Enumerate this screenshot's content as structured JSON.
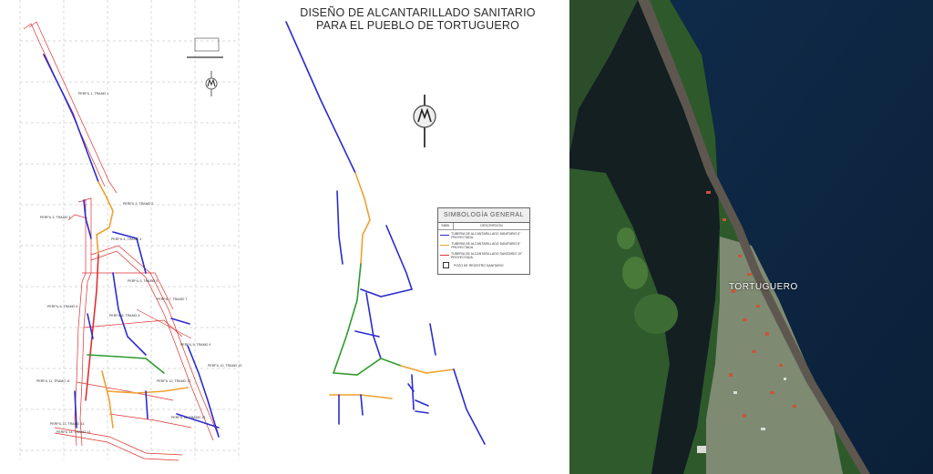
{
  "title": {
    "line1": "DISEÑO DE ALCANTARILLADO SANITARIO",
    "line2": "PARA EL PUEBLO DE TORTUGUERO"
  },
  "legend": {
    "heading": "SIMBOLOGÍA GENERAL",
    "col_symbol": "SIMB.",
    "col_description": "DESCRIPCIÓN",
    "items": [
      {
        "color": "#2b2bd0",
        "text": "TUBERIA DE ALCANTARILLADO SANITARIO 6\" PROYECTADA"
      },
      {
        "color": "#f0a030",
        "text": "TUBERIA DE ALCANTARILLADO SANITARIO 8\" PROYECTADA"
      },
      {
        "color": "#2e9a2e",
        "text": "TUBERIA DE ALCANTARILLADO SANITARIO 8\" PROYECTADA"
      },
      {
        "color": "#e03030",
        "text": "TUBERIA DE ALCANTARILLADO SANITARIO 10\" PROYECTADA"
      },
      {
        "color": "#333333",
        "text": "POZO DE REGISTRO SANITARIO"
      }
    ]
  },
  "plan_labels": [
    "PERFIL 1, TRAMO 1",
    "PERFIL 2, TRAMO 2",
    "PERFIL 3, TRAMO 3",
    "PERFIL 4, TRAMO 4",
    "PERFIL 5, TRAMO 5",
    "PERFIL 6, TRAMO 6",
    "PERFIL 7, TRAMO 7",
    "PERFIL 8, TRAMO 8",
    "PERFIL 9, TRAMO 9",
    "PERFIL 10, TRAMO 10",
    "PERFIL 11, TRAMO 11",
    "PERFIL 12, TRAMO 12",
    "PERFIL 13, TRAMO 13",
    "PERFIL 14, TRAMO 14",
    "PERFIL 15, TRAMO 15"
  ],
  "map_label": "TORTUGUERO",
  "colors": {
    "pipe_6in": "#2b2bd0",
    "pipe_8in": "#f0a030",
    "pipe_8in_green": "#2e9a2e",
    "pipe_10in": "#e03030",
    "lagoon": "#141f22",
    "sea": "#0e2a47",
    "forest": "#2f5a2c"
  }
}
